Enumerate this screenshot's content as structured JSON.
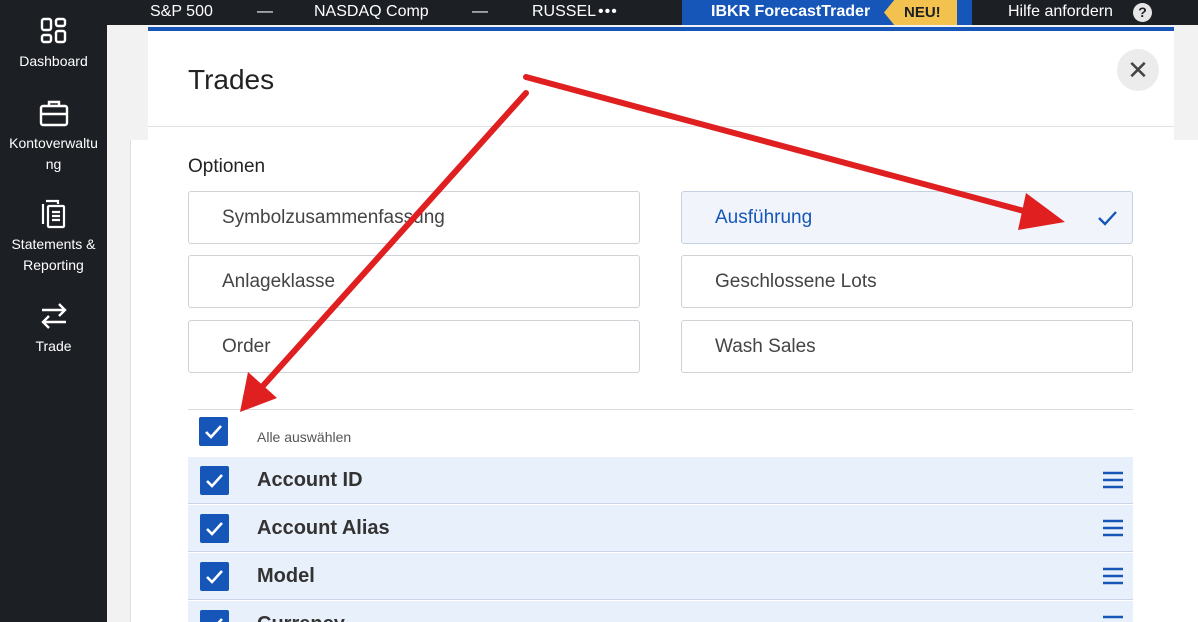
{
  "sidebar": {
    "items": [
      {
        "label": "Dashboard",
        "icon": "dashboard-icon"
      },
      {
        "label": "Kontoverwaltung",
        "icon": "briefcase-icon"
      },
      {
        "label": "Statements & Reporting",
        "icon": "documents-icon"
      },
      {
        "label": "Trade",
        "icon": "swap-arrows-icon"
      }
    ]
  },
  "topbar": {
    "tickers": [
      {
        "name": "S&P 500",
        "value": "—"
      },
      {
        "name": "NASDAQ Comp",
        "value": "—"
      },
      {
        "name": "RUSSEL"
      }
    ],
    "more": "•••",
    "promo_label": "IBKR ForecastTrader",
    "promo_badge": "NEU!",
    "help_label": "Hilfe anfordern",
    "help_icon": "?"
  },
  "modal": {
    "title": "Trades",
    "close": "✕",
    "options_heading": "Optionen",
    "options": [
      {
        "label": "Symbolzusammenfassung",
        "selected": false
      },
      {
        "label": "Ausführung",
        "selected": true
      },
      {
        "label": "Anlageklasse",
        "selected": false
      },
      {
        "label": "Geschlossene Lots",
        "selected": false
      },
      {
        "label": "Order",
        "selected": false
      },
      {
        "label": "Wash Sales",
        "selected": false
      }
    ],
    "select_all_label": "Alle auswählen",
    "columns": [
      {
        "label": "Account ID",
        "checked": true
      },
      {
        "label": "Account Alias",
        "checked": true
      },
      {
        "label": "Model",
        "checked": true
      },
      {
        "label": "Currency",
        "checked": true
      }
    ]
  },
  "colors": {
    "accent": "#1556b8",
    "sidebar_bg": "#1c1f24",
    "badge": "#f2c14e",
    "annotation_arrow": "#e02020"
  }
}
